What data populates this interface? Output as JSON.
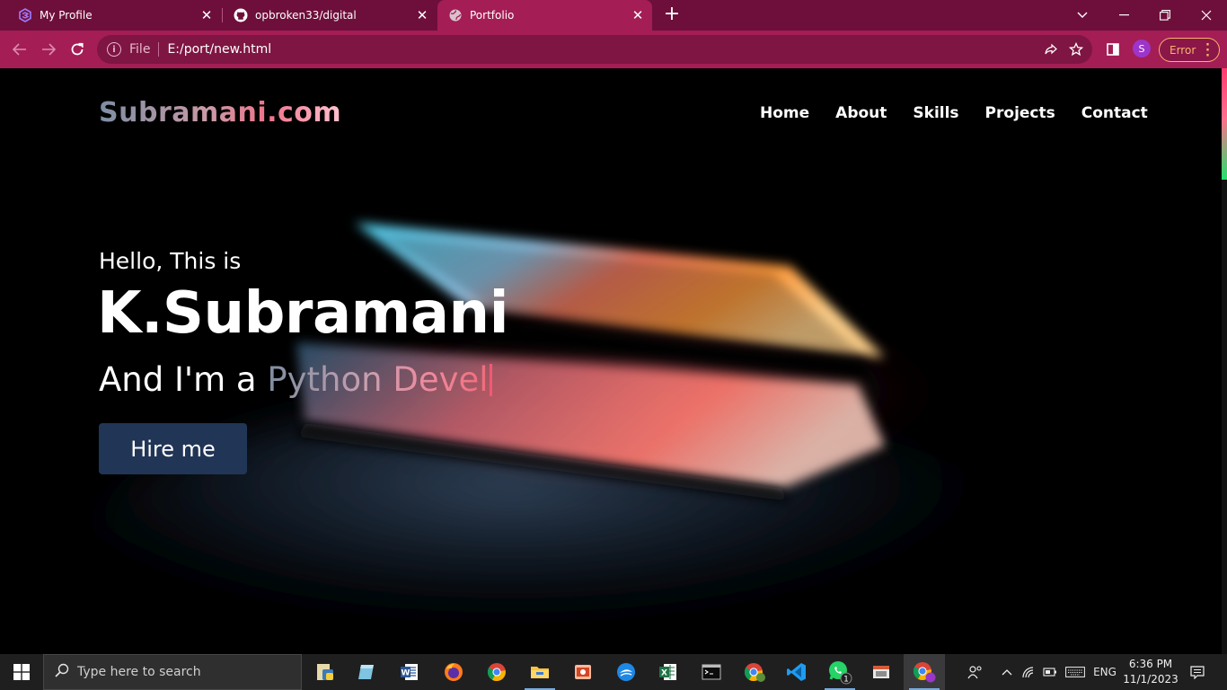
{
  "browser": {
    "tabs": [
      {
        "title": "My Profile",
        "icon": "stack-logo-icon"
      },
      {
        "title": "opbroken33/digital",
        "icon": "github-icon"
      },
      {
        "title": "Portfolio",
        "icon": "globe-icon",
        "active": true
      }
    ],
    "omnibox": {
      "scheme_label": "File",
      "url": "E:/port/new.html"
    },
    "profile_initial": "S",
    "error_label": "Error",
    "theme_color": "#a41d55"
  },
  "page": {
    "logo": "Subramani.com",
    "nav": [
      "Home",
      "About",
      "Skills",
      "Projects",
      "Contact"
    ],
    "hero": {
      "greeting": "Hello, This is",
      "name": "K.Subramani",
      "role_prefix": "And I'm a ",
      "role_typed": "Python Devel",
      "cta_label": "Hire me"
    }
  },
  "taskbar": {
    "search_placeholder": "Type here to search",
    "apps": [
      "file-explorer-python-icon",
      "notepad-icon",
      "word-icon",
      "firefox-icon",
      "chrome-icon",
      "file-explorer-icon",
      "powerpoint-icon",
      "app-icon",
      "excel-icon",
      "terminal-icon",
      "chrome-profile-icon",
      "vscode-icon",
      "whatsapp-icon",
      "snipping-icon",
      "chrome-active-icon"
    ],
    "whatsapp_badge": "1",
    "language": "ENG",
    "time": "6:36 PM",
    "date": "11/1/2023"
  }
}
